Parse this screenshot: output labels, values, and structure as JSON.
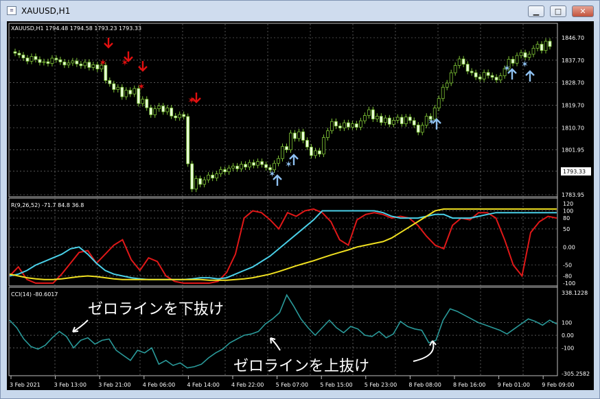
{
  "window": {
    "title": "XAUUSD,H1",
    "icon": "chart-window-icon",
    "buttons": {
      "minimize": "▁",
      "maximize": "□",
      "close": "✕"
    }
  },
  "main_panel": {
    "header": "XAUUSD,H1  1794.48 1794.58 1793.23 1793.33",
    "price_labels": [
      "1846.70",
      "1837.70",
      "1828.70",
      "1819.70",
      "1810.70",
      "1801.95",
      "1793.33",
      "1783.95"
    ],
    "current_price": "1793.33"
  },
  "rci_panel": {
    "header": "R(9,26,52) -71.7 84.8 36.8",
    "scale_labels": [
      "120",
      "100",
      "80",
      "50",
      "0.00",
      "-50",
      "-80",
      "-100"
    ]
  },
  "cci_panel": {
    "header": "CCI(14) -80.6017",
    "scale_labels": [
      "338.1228",
      "100",
      "0.00",
      "-100",
      "-305.2582"
    ],
    "annotation_down": "ゼロラインを下抜け",
    "annotation_up": "ゼロラインを上抜け"
  },
  "time_axis": [
    "3 Feb 2021",
    "3 Feb 13:00",
    "3 Feb 21:00",
    "4 Feb 06:00",
    "4 Feb 14:00",
    "4 Feb 22:00",
    "5 Feb 07:00",
    "5 Feb 15:00",
    "5 Feb 23:00",
    "8 Feb 08:00",
    "8 Feb 16:00",
    "9 Feb 01:00",
    "9 Feb 09:00"
  ],
  "colors": {
    "background": "#000000",
    "grid": "#8c8c8c",
    "candle": "#7fc636",
    "rci_short": "#e01818",
    "rci_mid": "#4ad0e8",
    "rci_long": "#f0e020",
    "cci": "#2a9a9a",
    "sell_signal": "#e01010",
    "buy_signal": "#8ec0f0"
  },
  "chart_data": [
    {
      "type": "candlestick",
      "title": "XAUUSD,H1",
      "ylim": [
        1783.95,
        1846.7
      ],
      "x_ticks": [
        "3 Feb 2021",
        "3 Feb 13:00",
        "3 Feb 21:00",
        "4 Feb 06:00",
        "4 Feb 14:00",
        "4 Feb 22:00",
        "5 Feb 07:00",
        "5 Feb 15:00",
        "5 Feb 23:00",
        "8 Feb 08:00",
        "8 Feb 16:00",
        "9 Feb 01:00",
        "9 Feb 09:00"
      ],
      "y_ticks": [
        1846.7,
        1837.7,
        1828.7,
        1819.7,
        1810.7,
        1801.95,
        1793.33,
        1783.95
      ],
      "close_series": [
        1840.5,
        1839.8,
        1838.6,
        1837.3,
        1839.2,
        1838.0,
        1836.8,
        1837.1,
        1836.4,
        1838.5,
        1837.9,
        1837.0,
        1835.8,
        1836.6,
        1837.4,
        1836.2,
        1835.5,
        1836.9,
        1834.8,
        1835.9,
        1834.2,
        1835.7,
        1829.6,
        1828.3,
        1826.0,
        1826.9,
        1823.1,
        1825.7,
        1824.2,
        1826.4,
        1820.4,
        1822.1,
        1818.7,
        1815.9,
        1818.3,
        1819.4,
        1817.1,
        1818.6,
        1815.4,
        1814.7,
        1816.0,
        1815.2,
        1796.3,
        1786.2,
        1790.4,
        1788.1,
        1789.9,
        1791.8,
        1790.6,
        1792.3,
        1794.0,
        1793.1,
        1794.6,
        1795.4,
        1794.3,
        1796.1,
        1795.0,
        1796.8,
        1795.7,
        1797.2,
        1796.0,
        1794.8,
        1793.9,
        1796.5,
        1798.4,
        1803.2,
        1801.9,
        1808.6,
        1806.4,
        1809.1,
        1805.7,
        1803.0,
        1799.6,
        1801.5,
        1800.2,
        1806.8,
        1809.5,
        1813.2,
        1811.4,
        1810.6,
        1812.7,
        1811.0,
        1812.3,
        1810.9,
        1813.5,
        1815.6,
        1817.9,
        1814.2,
        1815.3,
        1812.8,
        1814.6,
        1812.1,
        1813.7,
        1814.9,
        1812.3,
        1815.0,
        1813.6,
        1811.8,
        1808.9,
        1811.7,
        1815.3,
        1814.1,
        1818.6,
        1822.4,
        1826.9,
        1828.6,
        1832.7,
        1835.6,
        1838.2,
        1836.1,
        1833.3,
        1832.7,
        1831.0,
        1830.2,
        1832.8,
        1831.6,
        1830.9,
        1829.8,
        1831.5,
        1834.4,
        1838.1,
        1836.5,
        1839.6,
        1840.7,
        1838.9,
        1840.1,
        1842.5,
        1844.1,
        1841.6,
        1845.3,
        1843.2
      ]
    },
    {
      "type": "line",
      "title": "R(9,26,52)",
      "ylim": [
        -100,
        120
      ],
      "y_ticks": [
        120,
        100,
        80,
        50,
        0,
        -50,
        -80,
        -100
      ],
      "series": [
        {
          "name": "9",
          "values": [
            -80,
            -55,
            -90,
            -100,
            -100,
            -100,
            -75,
            -45,
            -15,
            -10,
            -45,
            -20,
            5,
            20,
            -35,
            -65,
            -30,
            -40,
            -80,
            -95,
            -100,
            -100,
            -100,
            -100,
            -95,
            -70,
            -20,
            80,
            100,
            95,
            75,
            50,
            95,
            85,
            100,
            105,
            95,
            70,
            20,
            5,
            75,
            90,
            95,
            90,
            80,
            85,
            80,
            60,
            30,
            5,
            -5,
            60,
            80,
            75,
            95,
            95,
            80,
            20,
            -50,
            -80,
            40,
            70,
            85,
            80
          ]
        },
        {
          "name": "26",
          "values": [
            -80,
            -75,
            -65,
            -50,
            -40,
            -30,
            -20,
            -5,
            0,
            -20,
            -45,
            -65,
            -75,
            -80,
            -85,
            -88,
            -90,
            -90,
            -90,
            -90,
            -90,
            -88,
            -85,
            -85,
            -88,
            -85,
            -75,
            -65,
            -55,
            -40,
            -25,
            -5,
            15,
            35,
            55,
            75,
            100,
            100,
            100,
            100,
            100,
            100,
            100,
            95,
            85,
            80,
            80,
            80,
            85,
            90,
            90,
            80,
            80,
            80,
            85,
            90,
            95,
            95,
            95,
            95,
            95,
            95,
            95,
            95
          ]
        },
        {
          "name": "52",
          "values": [
            -75,
            -80,
            -85,
            -88,
            -90,
            -90,
            -88,
            -85,
            -82,
            -80,
            -82,
            -85,
            -88,
            -90,
            -90,
            -90,
            -90,
            -90,
            -90,
            -90,
            -90,
            -90,
            -90,
            -92,
            -92,
            -92,
            -90,
            -88,
            -85,
            -80,
            -75,
            -68,
            -60,
            -52,
            -45,
            -38,
            -30,
            -22,
            -15,
            -8,
            0,
            5,
            10,
            15,
            25,
            40,
            55,
            70,
            85,
            100,
            105,
            105,
            105,
            105,
            105,
            105,
            105,
            105,
            105,
            105,
            105,
            105,
            105,
            105
          ]
        }
      ]
    },
    {
      "type": "line",
      "title": "CCI(14)",
      "ylim": [
        -305.2582,
        338.1228
      ],
      "y_ticks": [
        338.1228,
        100,
        0,
        -100,
        -305.2582
      ],
      "series": [
        {
          "name": "CCI",
          "values": [
            120,
            60,
            -30,
            -90,
            -110,
            -80,
            -20,
            30,
            -10,
            -100,
            -40,
            -20,
            -70,
            -40,
            -30,
            -120,
            -160,
            -200,
            -120,
            -140,
            -100,
            -230,
            -200,
            -240,
            -220,
            -260,
            -250,
            -230,
            -180,
            -140,
            -110,
            -60,
            -30,
            0,
            10,
            30,
            90,
            130,
            180,
            320,
            230,
            130,
            60,
            0,
            60,
            120,
            60,
            20,
            70,
            50,
            0,
            -10,
            30,
            -20,
            10,
            110,
            70,
            50,
            40,
            -60,
            -40,
            120,
            210,
            190,
            160,
            130,
            100,
            80,
            60,
            40,
            10,
            50,
            90,
            130,
            110,
            80,
            120,
            90
          ]
        }
      ]
    }
  ]
}
